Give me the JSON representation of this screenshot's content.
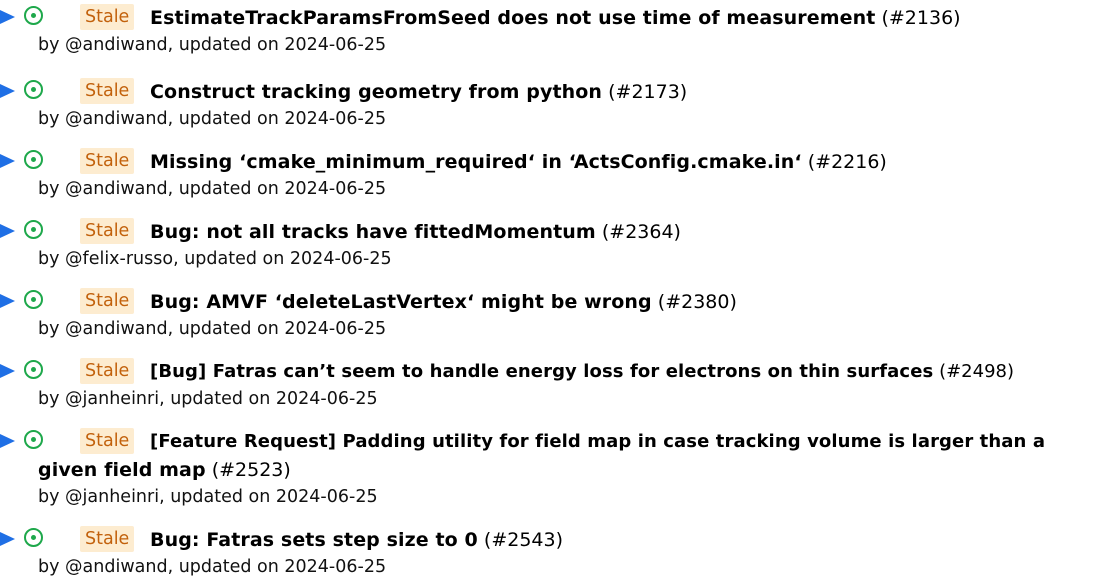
{
  "colors": {
    "toggle": "#1f6fe5",
    "status_open": "#1ea84b",
    "tag_bg": "#fdecd0",
    "tag_text": "#c2610c"
  },
  "icons": {
    "toggle": "triangle-right-icon",
    "status": "open-issue-icon"
  },
  "issues": [
    {
      "tag": "Stale",
      "title": "EstimateTrackParamsFromSeed does not use time of measurement",
      "number": "(#2136)",
      "by": "by",
      "author": "@andiwand",
      "updated_text": ", updated on 2024-06-25"
    },
    {
      "tag": "Stale",
      "title": "Construct tracking geometry from python",
      "number": "(#2173)",
      "by": "by",
      "author": "@andiwand",
      "updated_text": ", updated on 2024-06-25"
    },
    {
      "tag": "Stale",
      "title": "Missing ‘cmake_minimum_required‘ in ‘ActsConfig.cmake.in‘",
      "number": "(#2216)",
      "by": "by",
      "author": "@andiwand",
      "updated_text": ", updated on 2024-06-25"
    },
    {
      "tag": "Stale",
      "title": "Bug: not all tracks have fittedMomentum",
      "number": "(#2364)",
      "by": "by",
      "author": "@felix-russo",
      "updated_text": ", updated on 2024-06-25"
    },
    {
      "tag": "Stale",
      "title": "Bug: AMVF ‘deleteLastVertex‘ might be wrong",
      "number": "(#2380)",
      "by": "by",
      "author": "@andiwand",
      "updated_text": ", updated on 2024-06-25"
    },
    {
      "tag": "Stale",
      "title": "[Bug] Fatras can’t seem to handle energy loss for electrons on thin surfaces",
      "number": "(#2498)",
      "by": "by",
      "author": "@janheinri",
      "updated_text": ", updated on 2024-06-25"
    },
    {
      "tag": "Stale",
      "title": "[Feature Request] Padding utility for field map in case tracking volume is larger than a",
      "title_line2": "given field map",
      "number": "(#2523)",
      "by": "by",
      "author": "@janheinri",
      "updated_text": ", updated on 2024-06-25"
    },
    {
      "tag": "Stale",
      "title": "Bug: Fatras sets step size to 0",
      "number": "(#2543)",
      "by": "by",
      "author": "@andiwand",
      "updated_text": ", updated on 2024-06-25"
    }
  ]
}
